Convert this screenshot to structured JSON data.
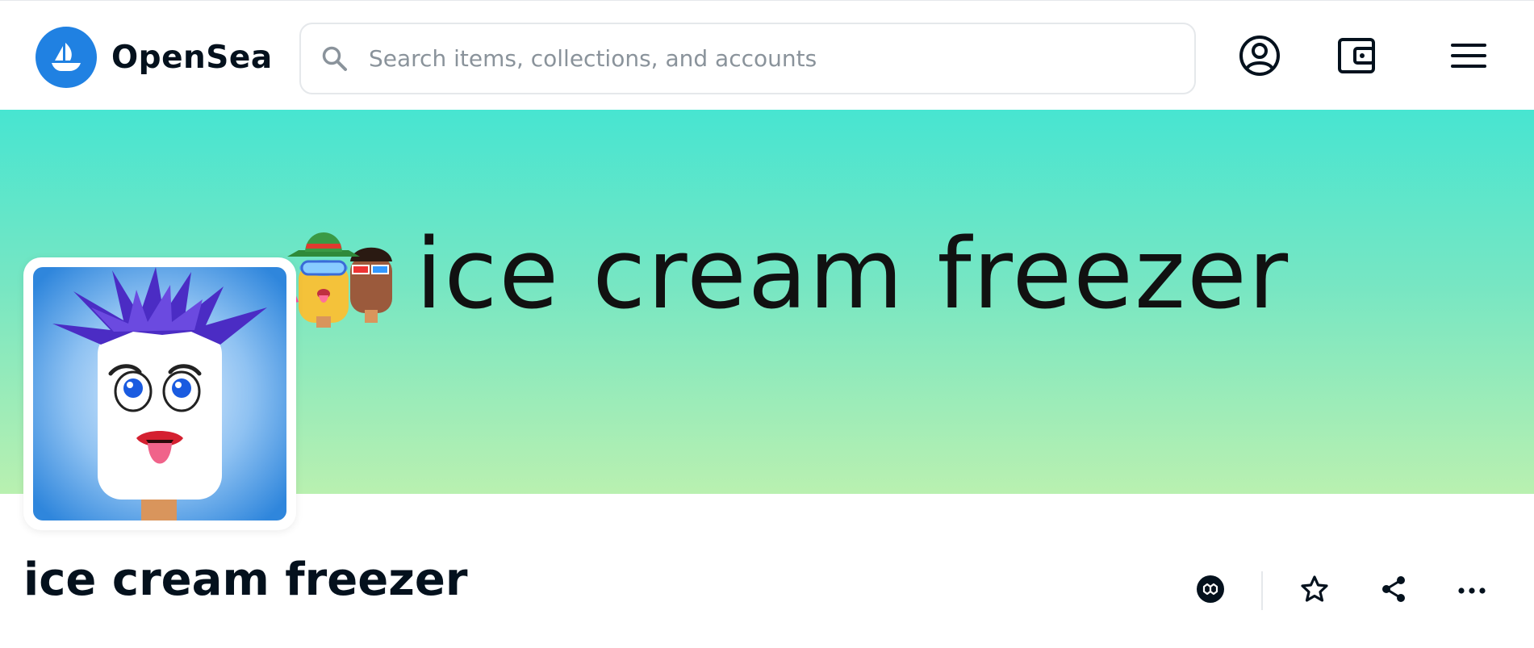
{
  "header": {
    "brand_name": "OpenSea",
    "logo_icon": "opensea-boat-icon",
    "search": {
      "placeholder": "Search items, collections, and accounts",
      "value": ""
    },
    "buttons": {
      "profile_icon": "user-circle-icon",
      "wallet_icon": "wallet-icon",
      "menu_icon": "hamburger-menu-icon"
    }
  },
  "banner": {
    "title": "ice cream freezer",
    "colors": {
      "top": "#47e5d1",
      "bottom": "#b9f0b0"
    }
  },
  "collection": {
    "name": "ice cream freezer",
    "actions": {
      "chain_icon": "polygon-chain-icon",
      "favorite_icon": "star-icon",
      "share_icon": "share-icon",
      "more_icon": "more-horizontal-icon"
    }
  },
  "colors": {
    "brand": "#2081e2",
    "text": "#04111d",
    "muted": "#8a939b",
    "border": "#e5e8eb"
  }
}
